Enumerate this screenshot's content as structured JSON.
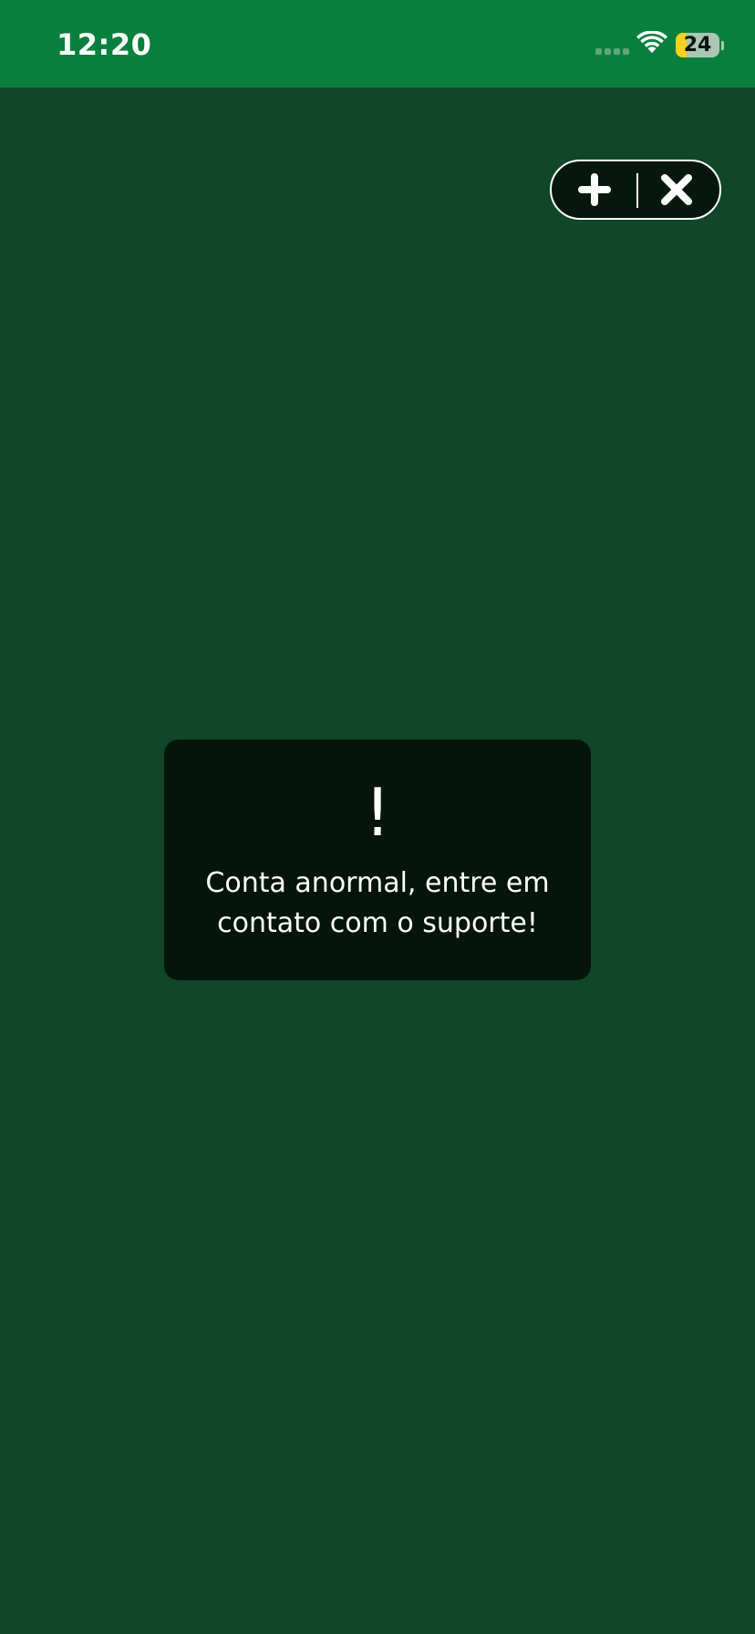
{
  "status_bar": {
    "time": "12:20",
    "battery_level": "24",
    "battery_fraction": 0.24,
    "background_color": "#08803d",
    "battery_color": "#f7d11e",
    "icons": [
      "cellular-signal-icon",
      "wifi-icon",
      "battery-icon"
    ]
  },
  "top_controls": {
    "buttons": [
      {
        "icon": "plus-icon",
        "action": "add"
      },
      {
        "icon": "close-icon",
        "action": "close"
      }
    ]
  },
  "toast": {
    "icon": "!",
    "message": "Conta anormal, entre em contato com o suporte!"
  },
  "colors": {
    "page_background": "#10472a",
    "toast_background": "#05150b",
    "capsule_background": "#06180e",
    "text": "#ffffff"
  }
}
